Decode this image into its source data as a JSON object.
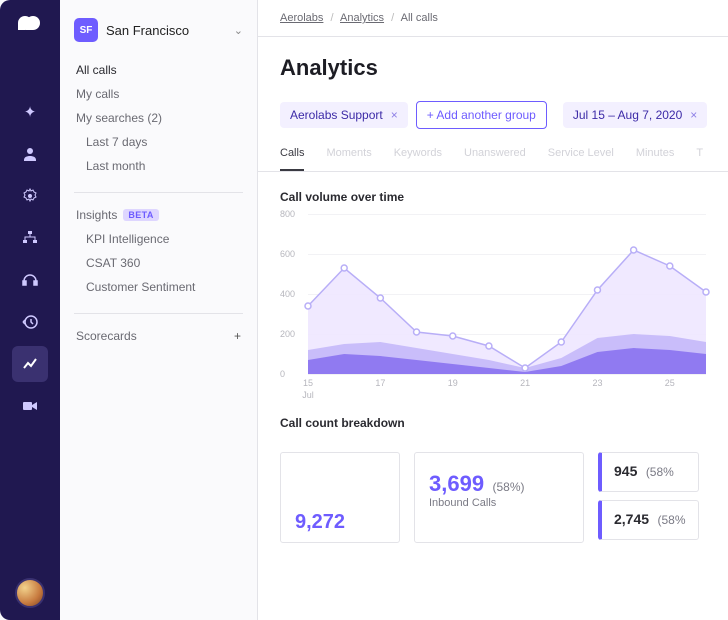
{
  "workspace": {
    "short": "SF",
    "name": "San Francisco"
  },
  "sidebar": {
    "items": [
      {
        "label": "All calls",
        "primary": true
      },
      {
        "label": "My calls"
      },
      {
        "label": "My searches (2)"
      },
      {
        "label": "Last 7 days",
        "sub": true
      },
      {
        "label": "Last month",
        "sub": true
      }
    ],
    "insights": {
      "label": "Insights",
      "badge": "BETA",
      "items": [
        {
          "label": "KPI Intelligence"
        },
        {
          "label": "CSAT 360"
        },
        {
          "label": "Customer Sentiment"
        }
      ]
    },
    "scorecards": {
      "label": "Scorecards",
      "plus": "+"
    }
  },
  "breadcrumb": {
    "a": "Aerolabs",
    "b": "Analytics",
    "c": "All calls"
  },
  "page": {
    "title": "Analytics"
  },
  "filters": {
    "group": "Aerolabs Support",
    "add": "+  Add another group",
    "range": "Jul 15 – Aug 7, 2020"
  },
  "tabs": [
    "Calls",
    "Moments",
    "Keywords",
    "Unanswered",
    "Service Level",
    "Minutes",
    "T"
  ],
  "active_tab": 0,
  "chart_title": "Call volume over time",
  "chart_data": {
    "type": "area",
    "title": "Call volume over time",
    "xlabel": "Jul",
    "ylabel": "",
    "ylim": [
      0,
      800
    ],
    "yticks": [
      0,
      200,
      400,
      600,
      800
    ],
    "x": [
      15,
      16,
      17,
      18,
      19,
      20,
      21,
      22,
      23,
      24,
      25,
      26
    ],
    "series": [
      {
        "name": "total",
        "values": [
          340,
          530,
          380,
          210,
          190,
          140,
          30,
          160,
          420,
          620,
          540,
          410
        ],
        "stroke": "#b8aef7",
        "fill": "#eee7ff",
        "dots": true
      },
      {
        "name": "seg-a",
        "values": [
          120,
          150,
          160,
          130,
          100,
          70,
          30,
          80,
          180,
          200,
          190,
          160
        ],
        "fill": "#c4b8fa",
        "opacity": 0.9
      },
      {
        "name": "seg-b",
        "values": [
          70,
          100,
          90,
          70,
          50,
          30,
          10,
          40,
          110,
          130,
          120,
          100
        ],
        "fill": "#8a72ef",
        "opacity": 0.9
      }
    ]
  },
  "breakdown": {
    "title": "Call count breakdown",
    "primary": {
      "value": "3,699",
      "pct": "(58%)",
      "label": "Inbound Calls"
    },
    "extra_value": "9,272",
    "right": [
      {
        "value": "945",
        "pct": "(58%"
      },
      {
        "value": "2,745",
        "pct": "(58%"
      }
    ]
  }
}
